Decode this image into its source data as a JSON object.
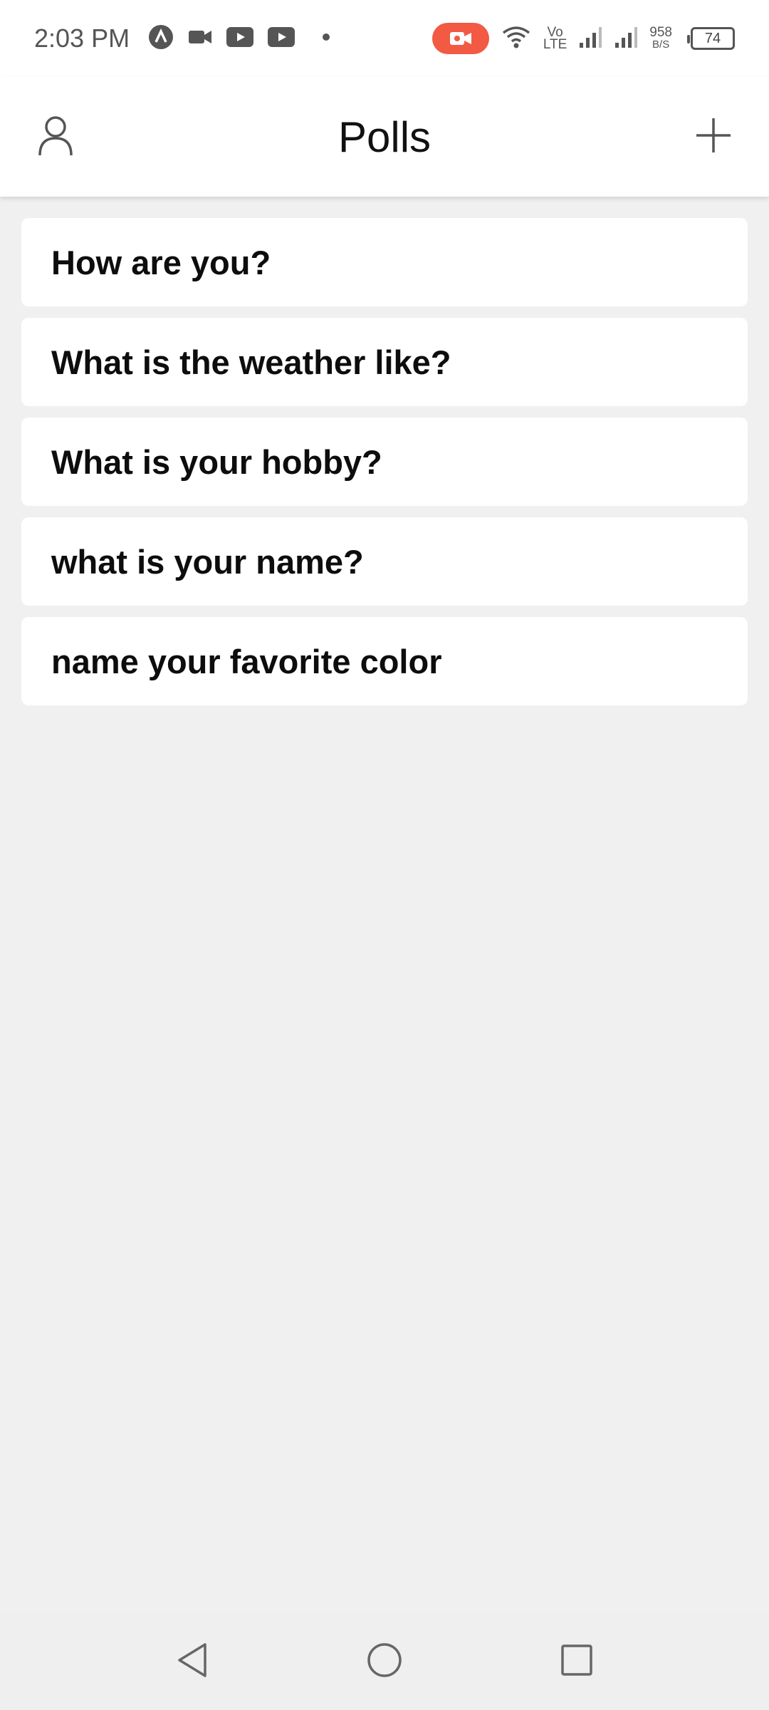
{
  "status_bar": {
    "time": "2:03 PM",
    "network_label_top": "Vo",
    "network_label_bottom": "LTE",
    "speed_value": "958",
    "speed_unit": "B/S",
    "battery_level": "74",
    "icons": [
      "app-a-icon",
      "video-camera-icon",
      "youtube-icon",
      "youtube-icon",
      "dot-icon",
      "screen-record-icon",
      "wifi-icon",
      "signal-icon",
      "signal-icon",
      "battery-icon"
    ],
    "record_color": "#f25a44"
  },
  "header": {
    "title": "Polls",
    "left_icon": "profile-icon",
    "right_icon": "plus-icon"
  },
  "polls": [
    {
      "label": "How are you?"
    },
    {
      "label": "What is the weather like?"
    },
    {
      "label": "What is your hobby?"
    },
    {
      "label": "what is your name?"
    },
    {
      "label": "name your favorite color"
    }
  ],
  "nav_bar": {
    "icons": [
      "back-icon",
      "home-icon",
      "recents-icon"
    ]
  }
}
